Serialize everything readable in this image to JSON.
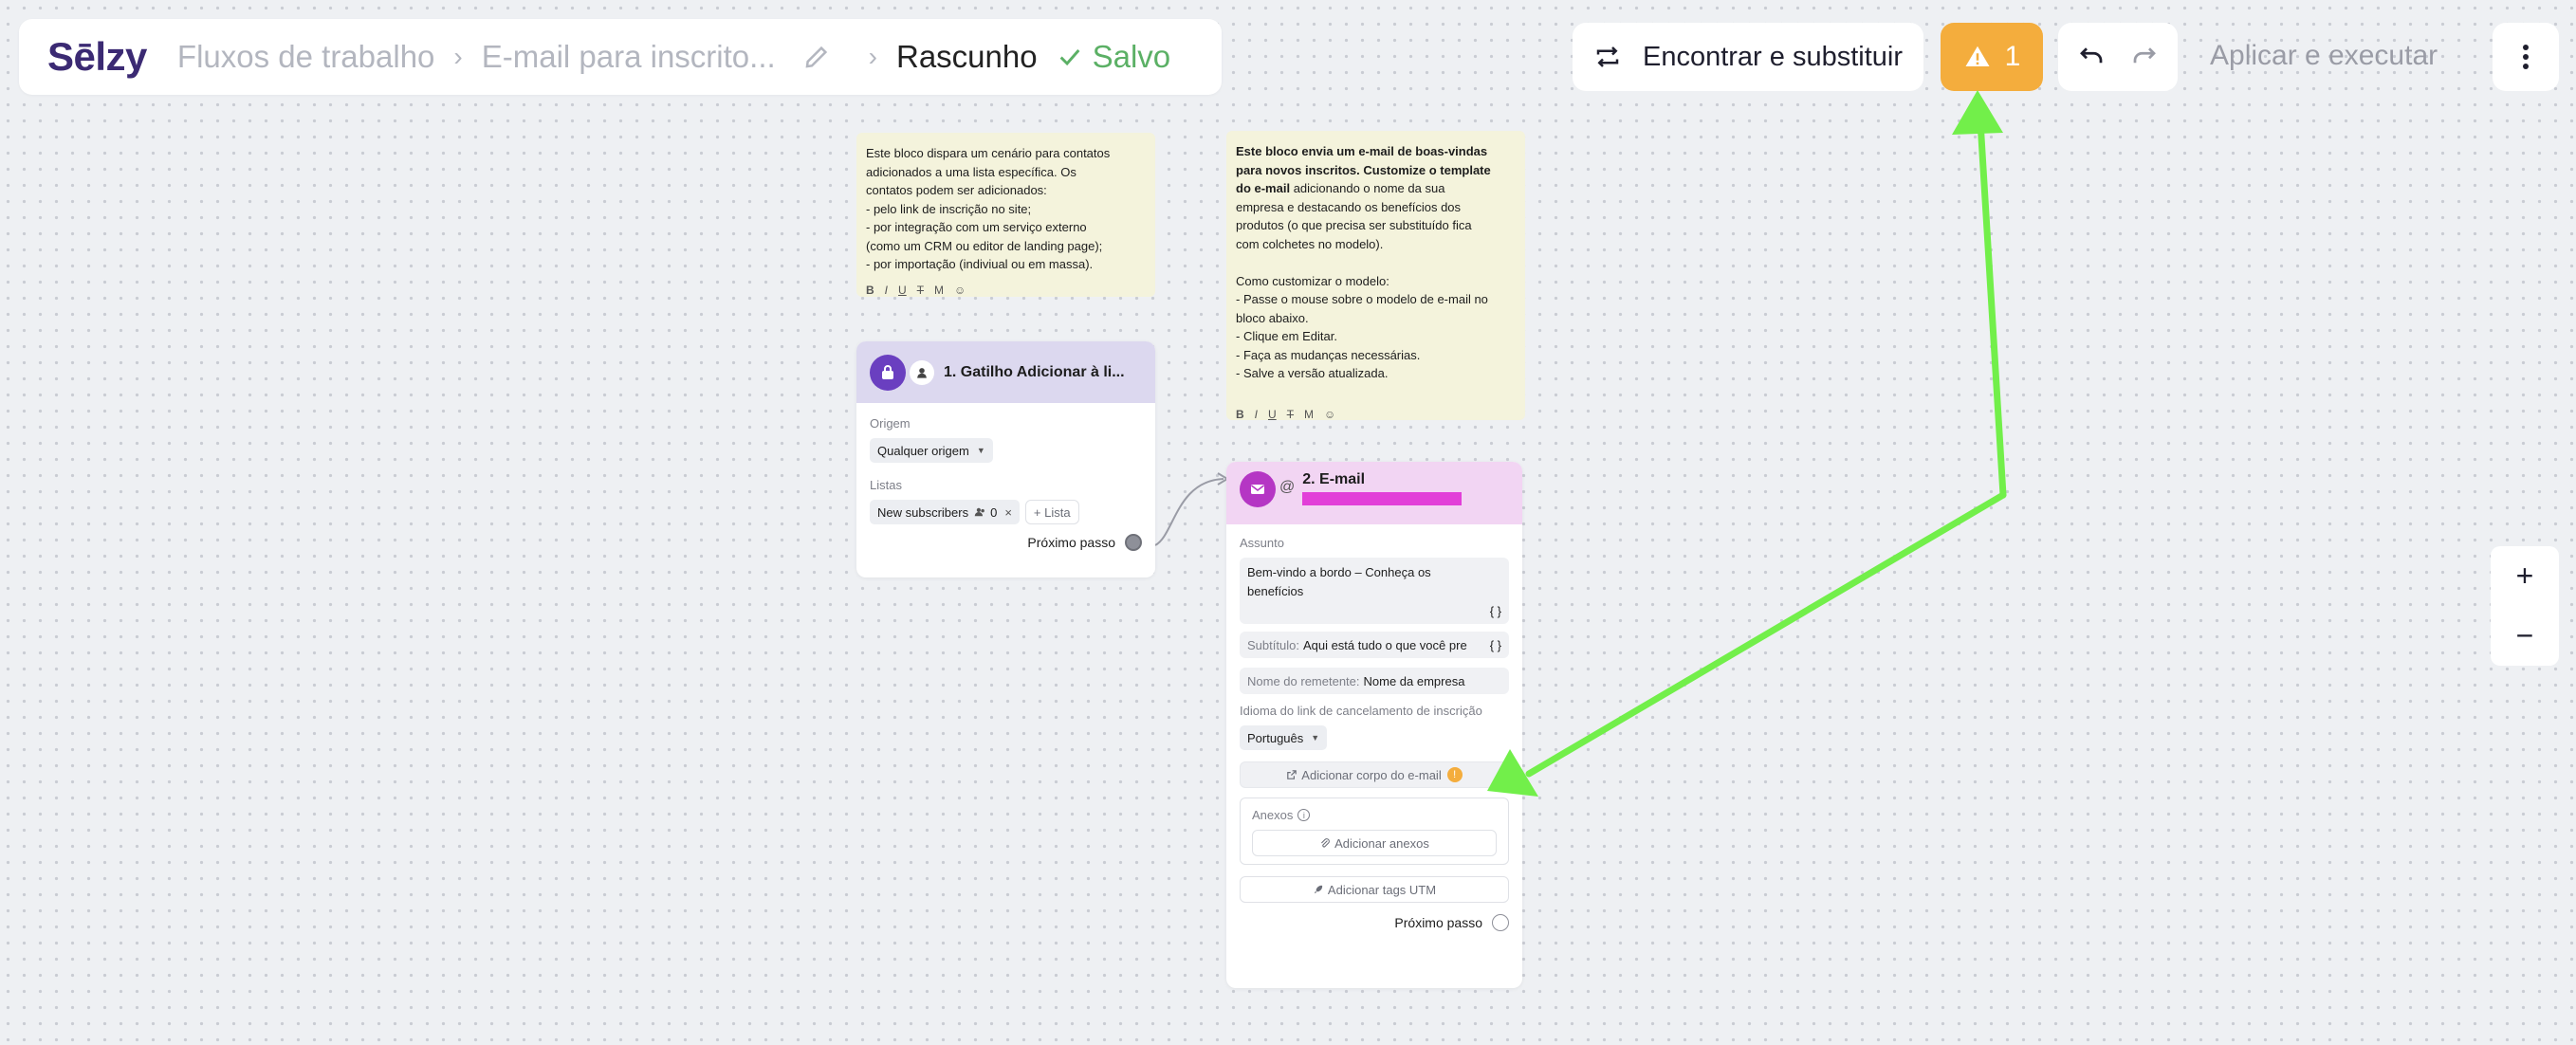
{
  "header": {
    "logo": "Sēlzy",
    "crumb_workflows": "Fluxos de trabalho",
    "crumb_workflow_name": "E-mail para inscrito...",
    "crumb_status": "Rascunho",
    "saved_label": "Salvo",
    "find_replace_label": "Encontrar e substituir",
    "warning_count": "1",
    "apply_label": "Aplicar e executar"
  },
  "note1": {
    "lines": [
      "Este bloco dispara um cenário para contatos",
      "adicionados a uma lista específica. Os",
      "contatos podem ser adicionados:",
      "- pelo link de inscrição no site;",
      "- por integração com um serviço externo",
      "(como um CRM ou editor de landing page);",
      "- por importação (indiviual ou em massa)."
    ],
    "toolbar": [
      "B",
      "I",
      "U",
      "T",
      "M",
      "☺"
    ]
  },
  "note2": {
    "bold_lines": [
      "Este bloco envia um e-mail de boas-vindas",
      "para novos inscritos. Customize o template"
    ],
    "mixed_line_bold": "do e-mail",
    "mixed_line_rest": " adicionando o nome da sua",
    "lines": [
      "empresa e destacando os benefícios dos",
      "produtos (o que precisa ser substituído fica",
      "com colchetes no modelo).",
      "",
      "Como customizar o modelo:",
      "- Passe o mouse sobre o modelo de e-mail no",
      "bloco abaixo.",
      "- Clique em Editar.",
      "- Faça as mudanças necessárias.",
      "- Salve a versão atualizada."
    ],
    "toolbar": [
      "B",
      "I",
      "U",
      "T",
      "M",
      "☺"
    ]
  },
  "trigger": {
    "title": "1. Gatilho Adicionar à li...",
    "origin_label": "Origem",
    "origin_value": "Qualquer origem",
    "lists_label": "Listas",
    "list_chip": "New subscribers",
    "list_count": "0",
    "add_list": "+ Lista",
    "next_step": "Próximo passo"
  },
  "email": {
    "title": "2. E-mail",
    "subject_label": "Assunto",
    "subject_line1": "Bem-vindo a bordo – Conheça os",
    "subject_line2": "benefícios",
    "var_token": "{ }",
    "subtitle_label": "Subtítulo:",
    "subtitle_value": "Aqui está tudo o que você pre",
    "sender_label": "Nome do remetente:",
    "sender_value": "Nome da empresa",
    "unsub_lang_label": "Idioma do link de cancelamento de inscrição",
    "language_value": "Português",
    "add_body": "Adicionar corpo do e-mail",
    "attachments_label": "Anexos",
    "add_attachments": "Adicionar anexos",
    "add_utm": "Adicionar tags UTM",
    "next_step": "Próximo passo"
  },
  "zoom": {
    "plus": "+",
    "minus": "−"
  },
  "colors": {
    "brand": "#3b2a73",
    "saved": "#5bb065",
    "warning": "#f4ad3d",
    "trigger_head": "#dcd8ef",
    "trigger_icon": "#6a3fc0",
    "email_head": "#f2d5f3",
    "email_icon": "#b536c4",
    "redacted": "#e23fd8",
    "arrow": "#72ef4a",
    "note_bg": "#f4f3dc"
  }
}
